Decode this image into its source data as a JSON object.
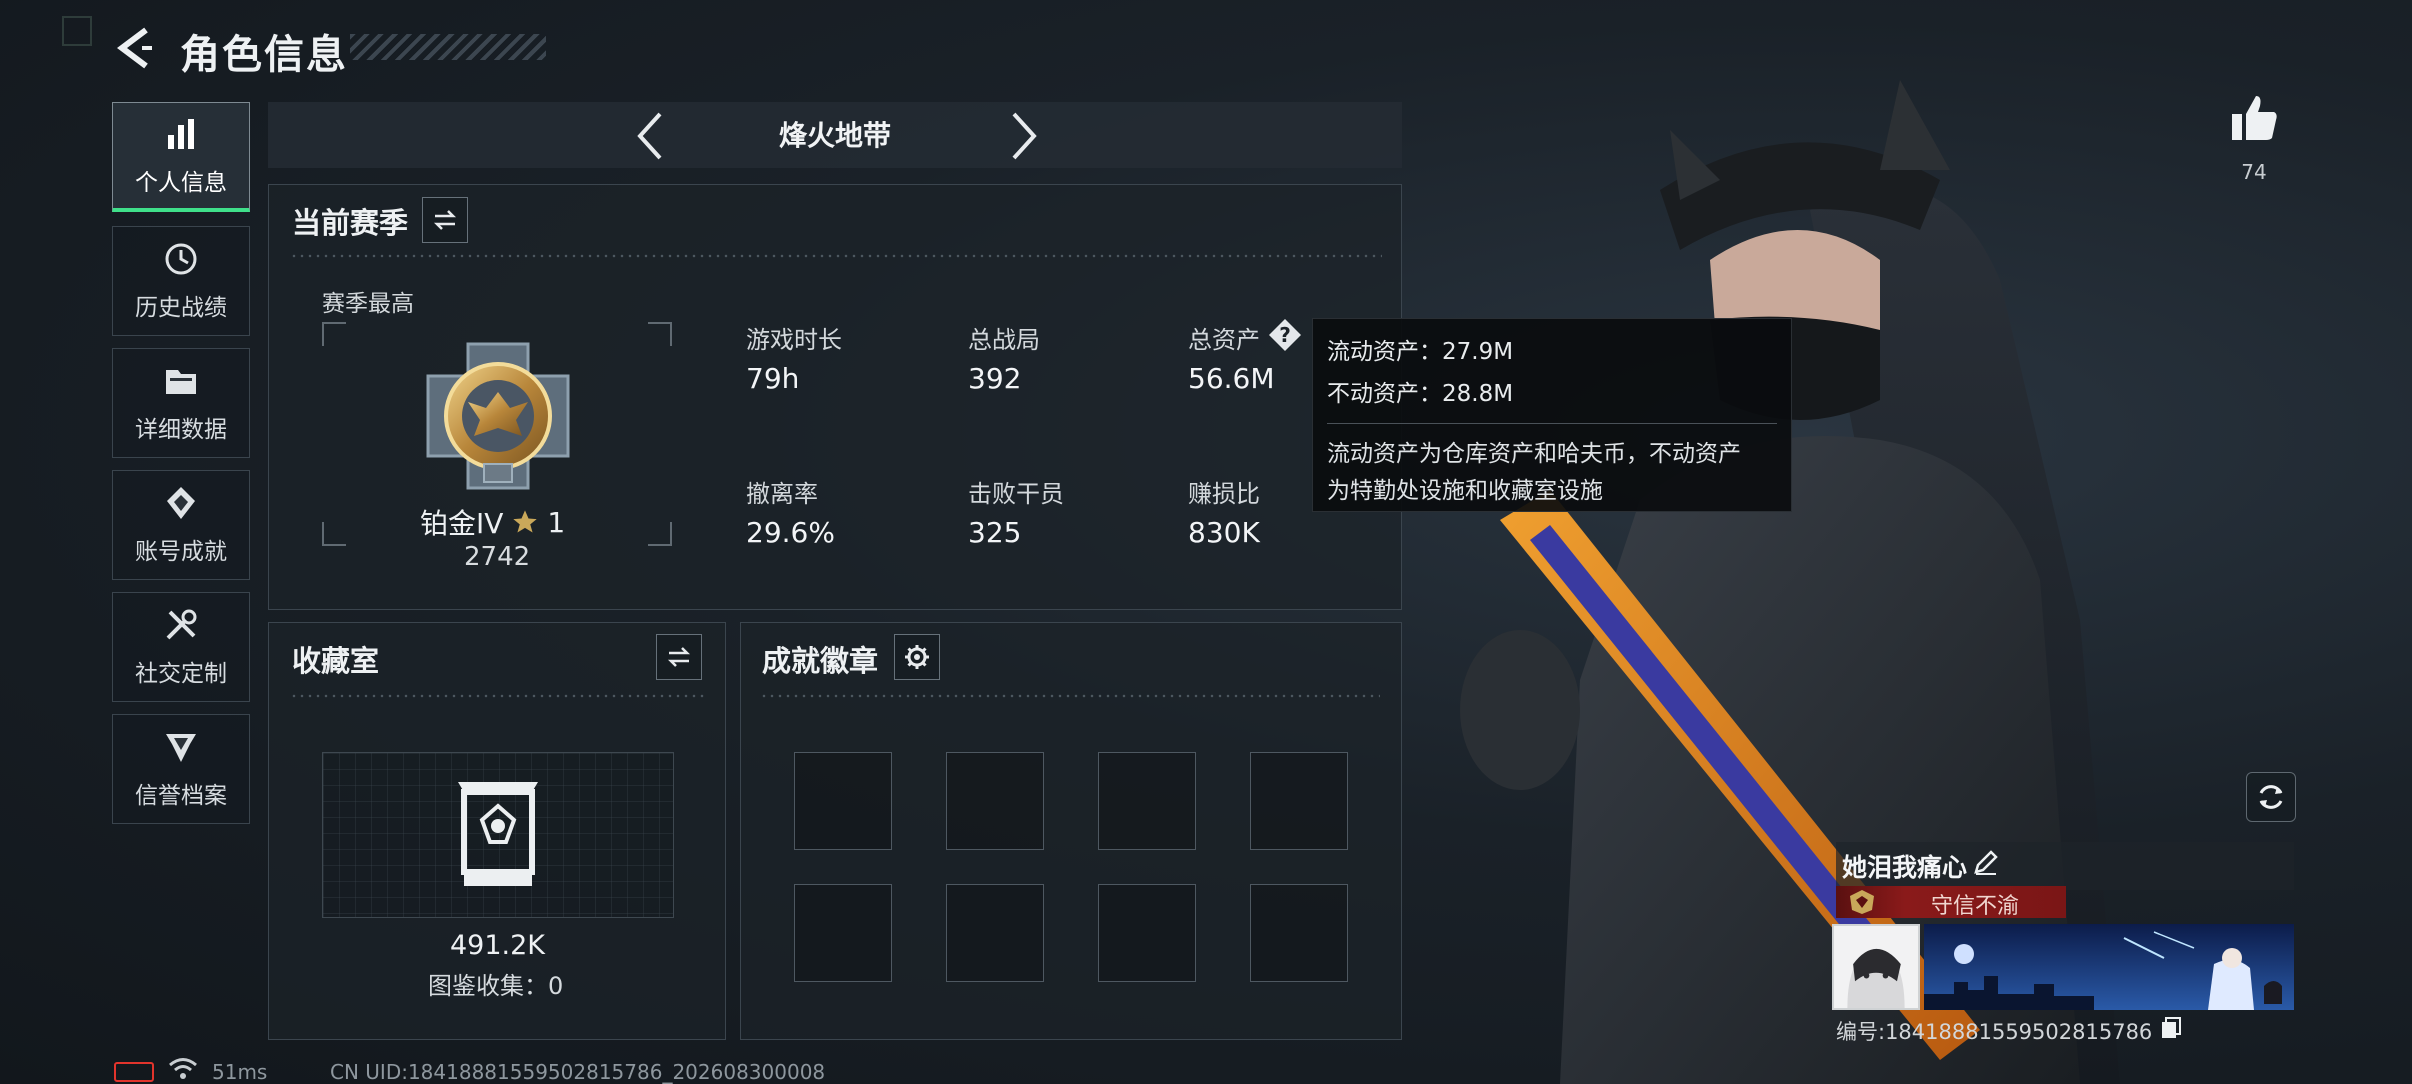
{
  "header": {
    "title": "角色信息"
  },
  "sidebar": {
    "items": [
      {
        "label": "个人信息",
        "icon": "bar-chart-icon",
        "active": true
      },
      {
        "label": "历史战绩",
        "icon": "history-icon",
        "active": false
      },
      {
        "label": "详细数据",
        "icon": "folder-icon",
        "active": false
      },
      {
        "label": "账号成就",
        "icon": "achievement-icon",
        "active": false
      },
      {
        "label": "社交定制",
        "icon": "tools-icon",
        "active": false
      },
      {
        "label": "信誉档案",
        "icon": "credit-shield-icon",
        "active": false
      }
    ]
  },
  "mode": {
    "label": "烽火地带"
  },
  "season": {
    "title": "当前赛季",
    "best_label": "赛季最高",
    "rank_name": "铂金IV",
    "rank_stars": "1",
    "rank_score": "2742",
    "stats": [
      {
        "label": "游戏时长",
        "value": "79h"
      },
      {
        "label": "总战局",
        "value": "392"
      },
      {
        "label": "总资产",
        "value": "56.6M"
      },
      {
        "label": "撤离率",
        "value": "29.6%"
      },
      {
        "label": "击败干员",
        "value": "325"
      },
      {
        "label": "赚损比",
        "value": "830K"
      }
    ]
  },
  "tooltip": {
    "liquid": "流动资产：27.9M",
    "fixed": "不动资产：28.8M",
    "desc_line1": "流动资产为仓库资产和哈夫币，不动资产",
    "desc_line2": "为特勤处设施和收藏室设施"
  },
  "collection": {
    "title": "收藏室",
    "value": "491.2K",
    "codex": "图鉴收集：0"
  },
  "badges": {
    "title": "成就徽章",
    "slots": 8
  },
  "profile": {
    "likes": "74",
    "name": "她泪我痛心",
    "title_badge": "守信不渝",
    "id_text": "编号:1841888155950281578​6"
  },
  "status_bar": {
    "ping": "51ms",
    "cn_uid": "CN UID:1841888155950281578​6_202608300008"
  },
  "colors": {
    "accent_green": "#3fe08a",
    "title_red": "#8a1a1a",
    "battery_red": "#e2342c",
    "gold": "#c9a85a"
  }
}
